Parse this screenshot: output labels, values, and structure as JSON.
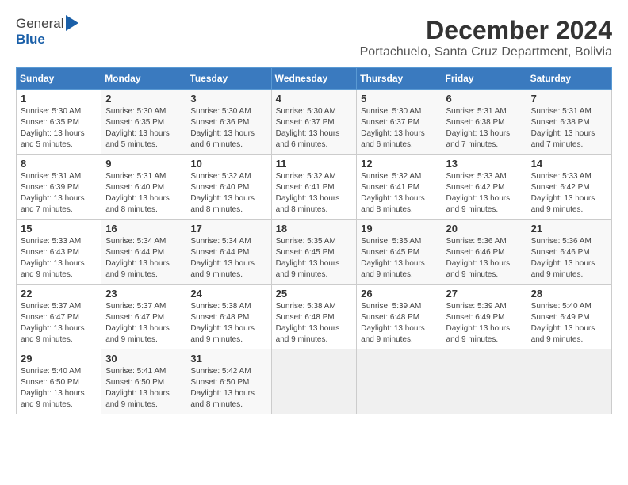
{
  "logo": {
    "general": "General",
    "blue": "Blue"
  },
  "title": "December 2024",
  "subtitle": "Portachuelo, Santa Cruz Department, Bolivia",
  "days_of_week": [
    "Sunday",
    "Monday",
    "Tuesday",
    "Wednesday",
    "Thursday",
    "Friday",
    "Saturday"
  ],
  "weeks": [
    [
      {
        "day": "1",
        "sunrise": "Sunrise: 5:30 AM",
        "sunset": "Sunset: 6:35 PM",
        "daylight": "Daylight: 13 hours and 5 minutes."
      },
      {
        "day": "2",
        "sunrise": "Sunrise: 5:30 AM",
        "sunset": "Sunset: 6:35 PM",
        "daylight": "Daylight: 13 hours and 5 minutes."
      },
      {
        "day": "3",
        "sunrise": "Sunrise: 5:30 AM",
        "sunset": "Sunset: 6:36 PM",
        "daylight": "Daylight: 13 hours and 6 minutes."
      },
      {
        "day": "4",
        "sunrise": "Sunrise: 5:30 AM",
        "sunset": "Sunset: 6:37 PM",
        "daylight": "Daylight: 13 hours and 6 minutes."
      },
      {
        "day": "5",
        "sunrise": "Sunrise: 5:30 AM",
        "sunset": "Sunset: 6:37 PM",
        "daylight": "Daylight: 13 hours and 6 minutes."
      },
      {
        "day": "6",
        "sunrise": "Sunrise: 5:31 AM",
        "sunset": "Sunset: 6:38 PM",
        "daylight": "Daylight: 13 hours and 7 minutes."
      },
      {
        "day": "7",
        "sunrise": "Sunrise: 5:31 AM",
        "sunset": "Sunset: 6:38 PM",
        "daylight": "Daylight: 13 hours and 7 minutes."
      }
    ],
    [
      {
        "day": "8",
        "sunrise": "Sunrise: 5:31 AM",
        "sunset": "Sunset: 6:39 PM",
        "daylight": "Daylight: 13 hours and 7 minutes."
      },
      {
        "day": "9",
        "sunrise": "Sunrise: 5:31 AM",
        "sunset": "Sunset: 6:40 PM",
        "daylight": "Daylight: 13 hours and 8 minutes."
      },
      {
        "day": "10",
        "sunrise": "Sunrise: 5:32 AM",
        "sunset": "Sunset: 6:40 PM",
        "daylight": "Daylight: 13 hours and 8 minutes."
      },
      {
        "day": "11",
        "sunrise": "Sunrise: 5:32 AM",
        "sunset": "Sunset: 6:41 PM",
        "daylight": "Daylight: 13 hours and 8 minutes."
      },
      {
        "day": "12",
        "sunrise": "Sunrise: 5:32 AM",
        "sunset": "Sunset: 6:41 PM",
        "daylight": "Daylight: 13 hours and 8 minutes."
      },
      {
        "day": "13",
        "sunrise": "Sunrise: 5:33 AM",
        "sunset": "Sunset: 6:42 PM",
        "daylight": "Daylight: 13 hours and 9 minutes."
      },
      {
        "day": "14",
        "sunrise": "Sunrise: 5:33 AM",
        "sunset": "Sunset: 6:42 PM",
        "daylight": "Daylight: 13 hours and 9 minutes."
      }
    ],
    [
      {
        "day": "15",
        "sunrise": "Sunrise: 5:33 AM",
        "sunset": "Sunset: 6:43 PM",
        "daylight": "Daylight: 13 hours and 9 minutes."
      },
      {
        "day": "16",
        "sunrise": "Sunrise: 5:34 AM",
        "sunset": "Sunset: 6:44 PM",
        "daylight": "Daylight: 13 hours and 9 minutes."
      },
      {
        "day": "17",
        "sunrise": "Sunrise: 5:34 AM",
        "sunset": "Sunset: 6:44 PM",
        "daylight": "Daylight: 13 hours and 9 minutes."
      },
      {
        "day": "18",
        "sunrise": "Sunrise: 5:35 AM",
        "sunset": "Sunset: 6:45 PM",
        "daylight": "Daylight: 13 hours and 9 minutes."
      },
      {
        "day": "19",
        "sunrise": "Sunrise: 5:35 AM",
        "sunset": "Sunset: 6:45 PM",
        "daylight": "Daylight: 13 hours and 9 minutes."
      },
      {
        "day": "20",
        "sunrise": "Sunrise: 5:36 AM",
        "sunset": "Sunset: 6:46 PM",
        "daylight": "Daylight: 13 hours and 9 minutes."
      },
      {
        "day": "21",
        "sunrise": "Sunrise: 5:36 AM",
        "sunset": "Sunset: 6:46 PM",
        "daylight": "Daylight: 13 hours and 9 minutes."
      }
    ],
    [
      {
        "day": "22",
        "sunrise": "Sunrise: 5:37 AM",
        "sunset": "Sunset: 6:47 PM",
        "daylight": "Daylight: 13 hours and 9 minutes."
      },
      {
        "day": "23",
        "sunrise": "Sunrise: 5:37 AM",
        "sunset": "Sunset: 6:47 PM",
        "daylight": "Daylight: 13 hours and 9 minutes."
      },
      {
        "day": "24",
        "sunrise": "Sunrise: 5:38 AM",
        "sunset": "Sunset: 6:48 PM",
        "daylight": "Daylight: 13 hours and 9 minutes."
      },
      {
        "day": "25",
        "sunrise": "Sunrise: 5:38 AM",
        "sunset": "Sunset: 6:48 PM",
        "daylight": "Daylight: 13 hours and 9 minutes."
      },
      {
        "day": "26",
        "sunrise": "Sunrise: 5:39 AM",
        "sunset": "Sunset: 6:48 PM",
        "daylight": "Daylight: 13 hours and 9 minutes."
      },
      {
        "day": "27",
        "sunrise": "Sunrise: 5:39 AM",
        "sunset": "Sunset: 6:49 PM",
        "daylight": "Daylight: 13 hours and 9 minutes."
      },
      {
        "day": "28",
        "sunrise": "Sunrise: 5:40 AM",
        "sunset": "Sunset: 6:49 PM",
        "daylight": "Daylight: 13 hours and 9 minutes."
      }
    ],
    [
      {
        "day": "29",
        "sunrise": "Sunrise: 5:40 AM",
        "sunset": "Sunset: 6:50 PM",
        "daylight": "Daylight: 13 hours and 9 minutes."
      },
      {
        "day": "30",
        "sunrise": "Sunrise: 5:41 AM",
        "sunset": "Sunset: 6:50 PM",
        "daylight": "Daylight: 13 hours and 9 minutes."
      },
      {
        "day": "31",
        "sunrise": "Sunrise: 5:42 AM",
        "sunset": "Sunset: 6:50 PM",
        "daylight": "Daylight: 13 hours and 8 minutes."
      },
      null,
      null,
      null,
      null
    ]
  ]
}
